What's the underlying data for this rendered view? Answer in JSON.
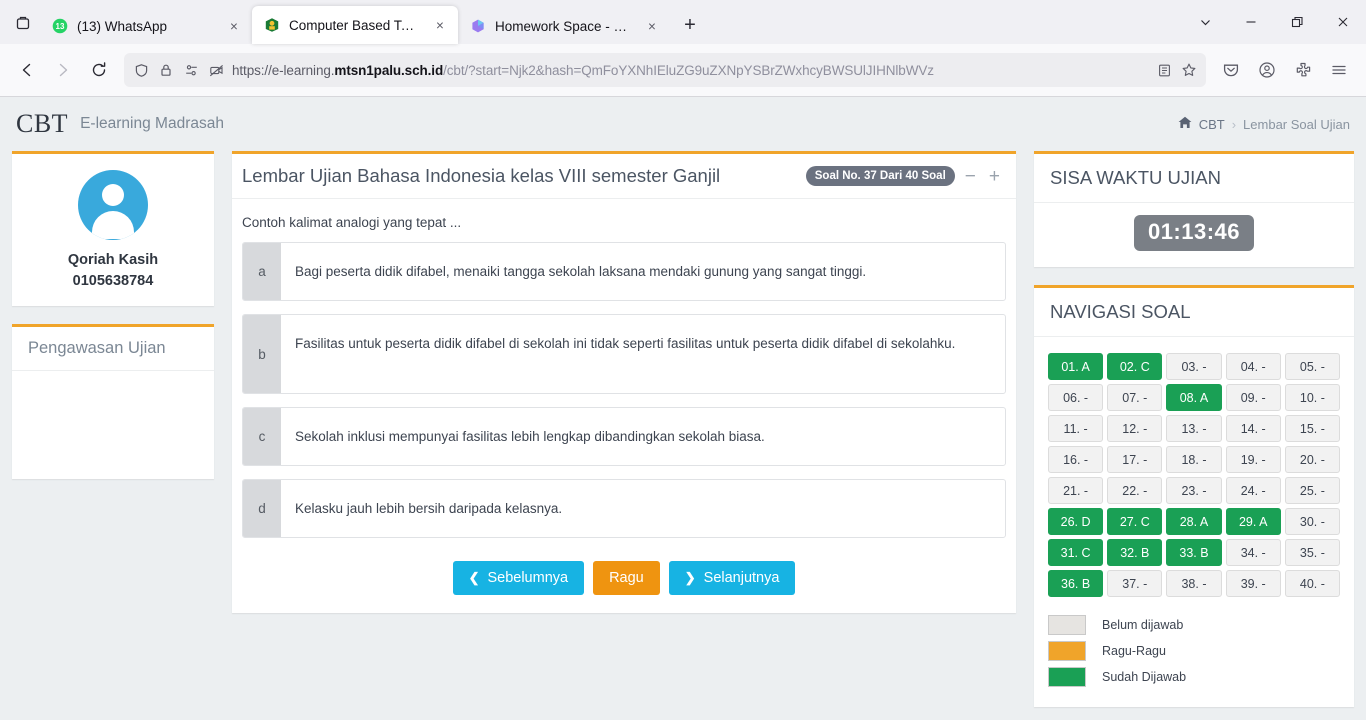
{
  "browser": {
    "tabs": [
      {
        "title": "(13) WhatsApp",
        "favicon": "whatsapp-icon",
        "active": false
      },
      {
        "title": "Computer Based Test (CBT)",
        "favicon": "madrasah-logo-icon",
        "active": true
      },
      {
        "title": "Homework Space - StudyX",
        "favicon": "studyx-icon",
        "active": false
      }
    ],
    "new_tab_label": "+",
    "tab_close_label": "×",
    "window_controls": {
      "minimize": "—",
      "maximize": "❐",
      "close": "✕",
      "tab_list": "⌄"
    },
    "toolbar": {
      "back": "←",
      "forward": "→",
      "reload": "⟳",
      "url_scheme": "https://e-learning.",
      "url_domain": "mtsn1palu.sch.id",
      "url_path": "/cbt/?start=Njk2&hash=QmFoYXNhIEluZG9uZXNpYSBrZWxhcyBWSUlJIHNlbWVz",
      "reader_icon": "reader-view-icon",
      "bookmark_icon": "star-icon",
      "shield_icon": "shield-icon",
      "lock_icon": "lock-icon",
      "permissions_icon": "permissions-icon",
      "camera_blocked_icon": "camera-blocked-icon",
      "pocket_icon": "pocket-icon",
      "account_icon": "account-icon",
      "extensions_icon": "extensions-icon",
      "menu_icon": "hamburger-menu-icon"
    }
  },
  "header": {
    "brand": "CBT",
    "brand_sub": "E-learning Madrasah",
    "breadcrumb": {
      "home_icon": "home-icon",
      "root": "CBT",
      "separator": "›",
      "current": "Lembar Soal Ujian"
    }
  },
  "sidebar": {
    "user": {
      "avatar_icon": "user-avatar-icon",
      "name": "Qoriah Kasih",
      "id": "0105638784"
    },
    "pengawasan_title": "Pengawasan Ujian"
  },
  "exam": {
    "title": "Lembar Ujian Bahasa Indonesia kelas VIII semester Ganjil",
    "badge": "Soal No. 37 Dari 40 Soal",
    "zoom_out": "−",
    "zoom_in": "+",
    "question": "Contoh kalimat analogi yang tepat ...",
    "options": [
      {
        "letter": "a",
        "text": "Bagi peserta didik difabel, menaiki tangga sekolah laksana mendaki gunung yang sangat tinggi."
      },
      {
        "letter": "b",
        "text": "Fasilitas untuk peserta didik difabel di sekolah ini tidak seperti fasilitas untuk peserta didik difabel di sekolahku."
      },
      {
        "letter": "c",
        "text": "Sekolah inklusi mempunyai fasilitas lebih lengkap dibandingkan sekolah biasa."
      },
      {
        "letter": "d",
        "text": "Kelasku jauh lebih bersih daripada kelasnya."
      }
    ],
    "buttons": {
      "prev": "Sebelumnya",
      "prev_icon": "chevron-left-icon",
      "doubt": "Ragu",
      "next": "Selanjutnya",
      "next_icon": "chevron-right-icon"
    }
  },
  "timer": {
    "title": "SISA WAKTU UJIAN",
    "value": "01:13:46"
  },
  "navigation": {
    "title": "NAVIGASI SOAL",
    "questions": [
      {
        "label": "01. A",
        "state": "answered"
      },
      {
        "label": "02. C",
        "state": "answered"
      },
      {
        "label": "03. -",
        "state": "unanswered"
      },
      {
        "label": "04. -",
        "state": "unanswered"
      },
      {
        "label": "05. -",
        "state": "unanswered"
      },
      {
        "label": "06. -",
        "state": "unanswered"
      },
      {
        "label": "07. -",
        "state": "unanswered"
      },
      {
        "label": "08. A",
        "state": "answered"
      },
      {
        "label": "09. -",
        "state": "unanswered"
      },
      {
        "label": "10. -",
        "state": "unanswered"
      },
      {
        "label": "11. -",
        "state": "unanswered"
      },
      {
        "label": "12. -",
        "state": "unanswered"
      },
      {
        "label": "13. -",
        "state": "unanswered"
      },
      {
        "label": "14. -",
        "state": "unanswered"
      },
      {
        "label": "15. -",
        "state": "unanswered"
      },
      {
        "label": "16. -",
        "state": "unanswered"
      },
      {
        "label": "17. -",
        "state": "unanswered"
      },
      {
        "label": "18. -",
        "state": "unanswered"
      },
      {
        "label": "19. -",
        "state": "unanswered"
      },
      {
        "label": "20. -",
        "state": "unanswered"
      },
      {
        "label": "21. -",
        "state": "unanswered"
      },
      {
        "label": "22. -",
        "state": "unanswered"
      },
      {
        "label": "23. -",
        "state": "unanswered"
      },
      {
        "label": "24. -",
        "state": "unanswered"
      },
      {
        "label": "25. -",
        "state": "unanswered"
      },
      {
        "label": "26. D",
        "state": "answered"
      },
      {
        "label": "27. C",
        "state": "answered"
      },
      {
        "label": "28. A",
        "state": "answered"
      },
      {
        "label": "29. A",
        "state": "answered"
      },
      {
        "label": "30. -",
        "state": "unanswered"
      },
      {
        "label": "31. C",
        "state": "answered"
      },
      {
        "label": "32. B",
        "state": "answered"
      },
      {
        "label": "33. B",
        "state": "answered"
      },
      {
        "label": "34. -",
        "state": "unanswered"
      },
      {
        "label": "35. -",
        "state": "unanswered"
      },
      {
        "label": "36. B",
        "state": "answered"
      },
      {
        "label": "37. -",
        "state": "unanswered"
      },
      {
        "label": "38. -",
        "state": "unanswered"
      },
      {
        "label": "39. -",
        "state": "unanswered"
      },
      {
        "label": "40. -",
        "state": "unanswered"
      }
    ],
    "legend": [
      {
        "label": "Belum dijawab",
        "color": "#e6e4e1"
      },
      {
        "label": "Ragu-Ragu",
        "color": "#f0a42a"
      },
      {
        "label": "Sudah Dijawab",
        "color": "#1aa055"
      }
    ]
  },
  "colors": {
    "accent_orange": "#f0a42a",
    "answered_green": "#1aa055",
    "info_blue": "#17b3e3",
    "page_bg": "#eceff1"
  }
}
